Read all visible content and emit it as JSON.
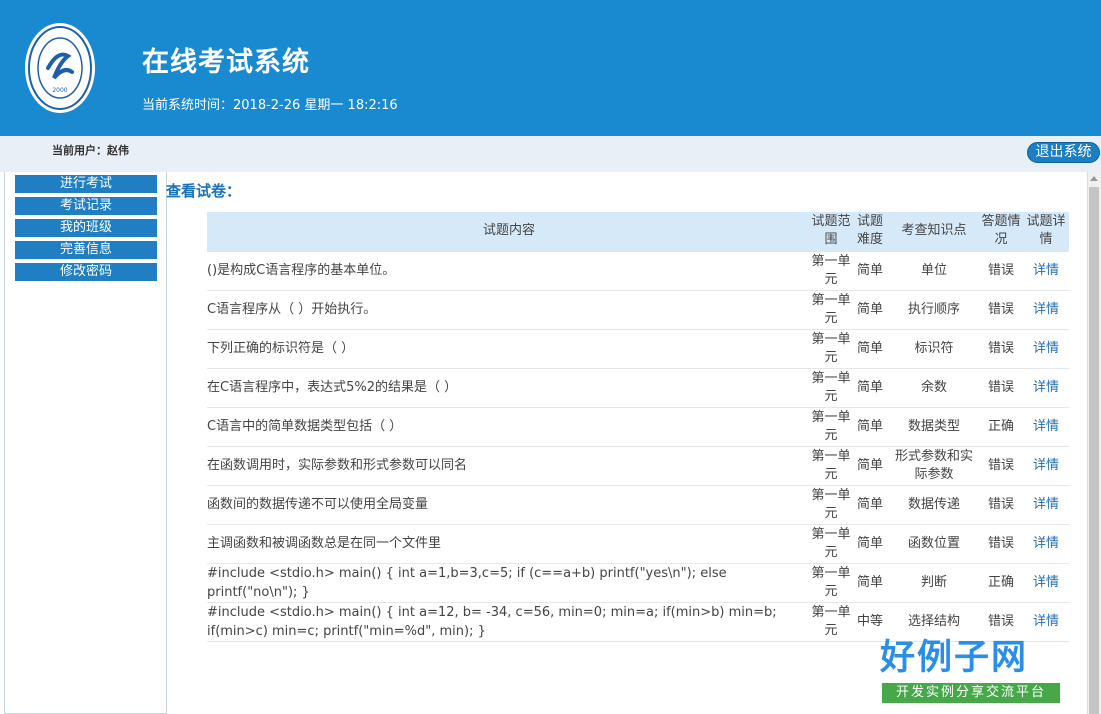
{
  "header": {
    "title": "在线考试系统",
    "time_label": "当前系统时间：",
    "time_value": "2018-2-26 星期一 18:2:16",
    "logo_year": "2000"
  },
  "userbar": {
    "user_label": "当前用户：赵伟",
    "logout_label": "退出系统"
  },
  "sidebar": {
    "items": [
      {
        "label": "进行考试"
      },
      {
        "label": "考试记录"
      },
      {
        "label": "我的班级"
      },
      {
        "label": "完善信息"
      },
      {
        "label": "修改密码"
      }
    ]
  },
  "main": {
    "title": "查看试卷："
  },
  "table": {
    "headers": {
      "content": "试题内容",
      "scope": "试题范围",
      "difficulty": "试题难度",
      "knowledge": "考查知识点",
      "status": "答题情况",
      "detail": "试题详情"
    },
    "rows": [
      {
        "content": "()是构成C语言程序的基本单位。",
        "scope": "第一单元",
        "difficulty": "简单",
        "knowledge": "单位",
        "status": "错误",
        "detail": "详情"
      },
      {
        "content": "C语言程序从（ ）开始执行。",
        "scope": "第一单元",
        "difficulty": "简单",
        "knowledge": "执行顺序",
        "status": "错误",
        "detail": "详情"
      },
      {
        "content": "下列正确的标识符是（ ）",
        "scope": "第一单元",
        "difficulty": "简单",
        "knowledge": "标识符",
        "status": "错误",
        "detail": "详情"
      },
      {
        "content": "在C语言程序中，表达式5%2的结果是（ ）",
        "scope": "第一单元",
        "difficulty": "简单",
        "knowledge": "余数",
        "status": "错误",
        "detail": "详情"
      },
      {
        "content": "C语言中的简单数据类型包括（ ）",
        "scope": "第一单元",
        "difficulty": "简单",
        "knowledge": "数据类型",
        "status": "正确",
        "detail": "详情"
      },
      {
        "content": "在函数调用时，实际参数和形式参数可以同名",
        "scope": "第一单元",
        "difficulty": "简单",
        "knowledge": "形式参数和实际参数",
        "status": "错误",
        "detail": "详情"
      },
      {
        "content": "函数间的数据传递不可以使用全局变量",
        "scope": "第一单元",
        "difficulty": "简单",
        "knowledge": "数据传递",
        "status": "错误",
        "detail": "详情"
      },
      {
        "content": "主调函数和被调函数总是在同一个文件里",
        "scope": "第一单元",
        "difficulty": "简单",
        "knowledge": "函数位置",
        "status": "错误",
        "detail": "详情"
      },
      {
        "content": "#include <stdio.h> main() { int a=1,b=3,c=5; if (c==a+b) printf(\"yes\\n\"); else printf(\"no\\n\"); }",
        "scope": "第一单元",
        "difficulty": "简单",
        "knowledge": "判断",
        "status": "正确",
        "detail": "详情"
      },
      {
        "content": "#include <stdio.h> main() { int a=12, b= -34, c=56, min=0; min=a; if(min>b) min=b; if(min>c) min=c; printf(\"min=%d\", min); }",
        "scope": "第一单元",
        "difficulty": "中等",
        "knowledge": "选择结构",
        "status": "错误",
        "detail": "详情"
      }
    ]
  },
  "watermark": {
    "title": "好例子网",
    "subtitle": "开发实例分享交流平台"
  },
  "colors": {
    "header_bg": "#1a8ad0",
    "nav_bg": "#1f7fc2",
    "table_header_bg": "#d6e9f8",
    "link": "#1f6fb5"
  }
}
